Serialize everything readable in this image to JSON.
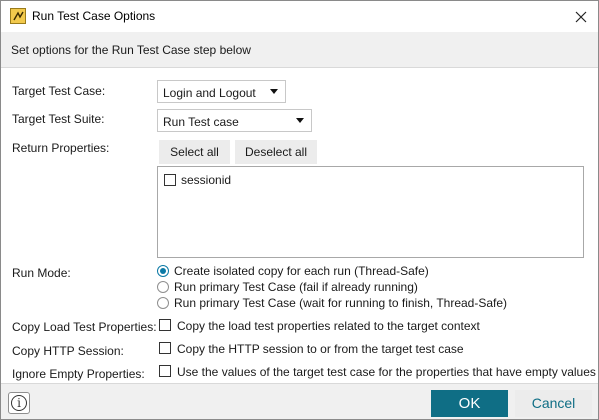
{
  "window": {
    "title": "Run Test Case Options",
    "app_icon": "readyapi-icon",
    "close_icon": "close-icon"
  },
  "header": {
    "text": "Set options for the Run Test Case step below"
  },
  "form": {
    "target_test_case": {
      "label": "Target Test Case:",
      "value": "Login and Logout"
    },
    "target_test_suite": {
      "label": "Target Test Suite:",
      "value": "Run Test case"
    },
    "return_properties": {
      "label": "Return Properties:",
      "select_all": "Select all",
      "deselect_all": "Deselect all",
      "items": [
        {
          "label": "sessionid",
          "checked": false
        }
      ]
    },
    "run_mode": {
      "label": "Run Mode:",
      "options": [
        {
          "label": "Create isolated copy for each run (Thread-Safe)",
          "selected": true
        },
        {
          "label": "Run primary Test Case (fail if already running)",
          "selected": false
        },
        {
          "label": "Run primary Test Case (wait for running to finish, Thread-Safe)",
          "selected": false
        }
      ]
    },
    "copy_load_test_properties": {
      "label": "Copy Load Test Properties:",
      "text": "Copy the load test properties related to the target context",
      "checked": false
    },
    "copy_http_session": {
      "label": "Copy HTTP Session:",
      "text": "Copy the HTTP session to or from the target test case",
      "checked": false
    },
    "ignore_empty_properties": {
      "label": "Ignore Empty Properties:",
      "text": "Use the values of the target test case for the properties that have empty values",
      "checked": false
    }
  },
  "footer": {
    "info_icon": "info-icon",
    "info_glyph": "i",
    "ok": "OK",
    "cancel": "Cancel"
  },
  "colors": {
    "accent": "#0f6e85",
    "radio_selected": "#0c7aa6",
    "header_bg": "#f0f0f0"
  }
}
